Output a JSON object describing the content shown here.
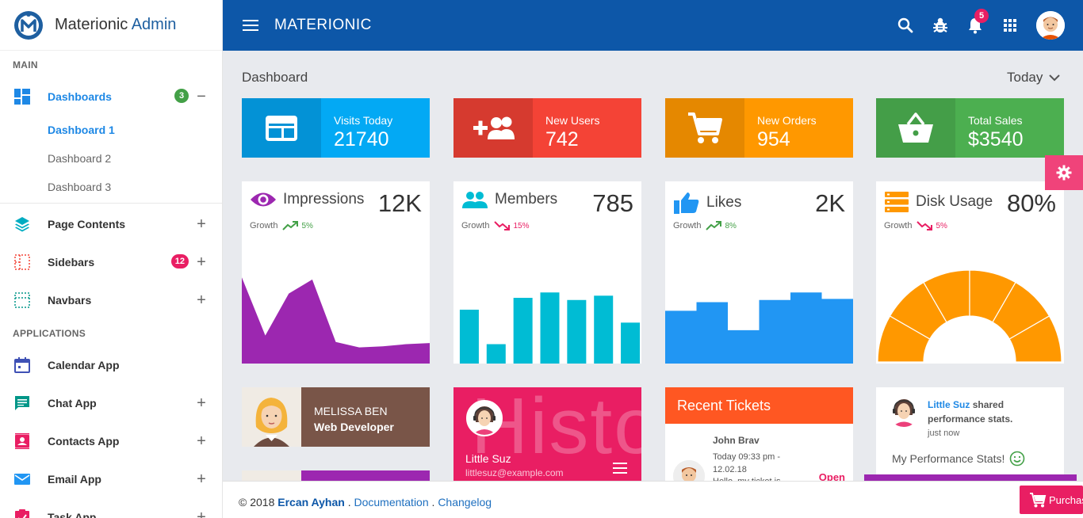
{
  "brand": {
    "name_part1": "Materionic",
    "name_part2": "Admin"
  },
  "sidebar": {
    "section_main": "MAIN",
    "section_apps": "APPLICATIONS",
    "dashboards": {
      "label": "Dashboards",
      "badge": "3",
      "toggle": "−",
      "icon": "dashboard-icon"
    },
    "sub_items": [
      "Dashboard 1",
      "Dashboard 2",
      "Dashboard 3"
    ],
    "page_contents": {
      "label": "Page Contents",
      "toggle": "+",
      "icon": "layers-icon"
    },
    "sidebars": {
      "label": "Sidebars",
      "badge": "12",
      "toggle": "+",
      "icon": "sidebar-grid-icon"
    },
    "navbars": {
      "label": "Navbars",
      "toggle": "+",
      "icon": "navbar-grid-icon"
    },
    "calendar": {
      "label": "Calendar App",
      "icon": "calendar-icon"
    },
    "chat": {
      "label": "Chat App",
      "toggle": "+",
      "icon": "chat-icon"
    },
    "contacts": {
      "label": "Contacts App",
      "toggle": "+",
      "icon": "contacts-icon"
    },
    "email": {
      "label": "Email App",
      "toggle": "+",
      "icon": "email-icon"
    },
    "task": {
      "label": "Task App",
      "toggle": "+",
      "icon": "task-icon"
    }
  },
  "topbar": {
    "title": "MATERIONIC",
    "notifications": "5"
  },
  "content": {
    "title": "Dashboard",
    "period": "Today"
  },
  "stats": [
    {
      "label": "Visits Today",
      "value": "21740",
      "color": "#03a9f4",
      "icon": "visits-icon"
    },
    {
      "label": "New Users",
      "value": "742",
      "color": "#f44336",
      "icon": "add-users-icon"
    },
    {
      "label": "New Orders",
      "value": "954",
      "color": "#ff9800",
      "icon": "cart-icon"
    },
    {
      "label": "Total Sales",
      "value": "$3540",
      "color": "#4caf50",
      "icon": "basket-icon"
    }
  ],
  "cards": {
    "impressions": {
      "title": "Impressions",
      "value": "12K",
      "growth_label": "Growth",
      "growth": "5%",
      "trend": "up",
      "icon": "eye-icon"
    },
    "members": {
      "title": "Members",
      "value": "785",
      "growth_label": "Growth",
      "growth": "15%",
      "trend": "down",
      "icon": "people-icon"
    },
    "likes": {
      "title": "Likes",
      "value": "2K",
      "growth_label": "Growth",
      "growth": "8%",
      "trend": "up",
      "icon": "thumbs-up-icon"
    },
    "disk": {
      "title": "Disk Usage",
      "value": "80%",
      "growth_label": "Growth",
      "growth": "5%",
      "trend": "down",
      "icon": "storage-icon"
    }
  },
  "chart_data": [
    {
      "type": "area",
      "title": "Impressions",
      "values": [
        80,
        26,
        65,
        78,
        20,
        15,
        16,
        18,
        19
      ],
      "color": "#9c27b0",
      "ylim": [
        0,
        100
      ]
    },
    {
      "type": "bar",
      "title": "Members",
      "values": [
        50,
        18,
        61,
        66,
        59,
        63,
        38
      ],
      "color": "#00bcd4",
      "ylim": [
        0,
        100
      ]
    },
    {
      "type": "area",
      "title": "Likes",
      "values": [
        49,
        57,
        31,
        59,
        66,
        60
      ],
      "color": "#2196f3",
      "ylim": [
        0,
        100
      ]
    },
    {
      "type": "pie",
      "title": "Disk Usage",
      "values": [
        80,
        20
      ],
      "color": "#ff9800"
    }
  ],
  "profile": {
    "name": "MELISSA BEN",
    "role": "Web Developer"
  },
  "history": {
    "bg_text": "Histo",
    "name": "Little Suz",
    "email": "littlesuz@example.com"
  },
  "tickets": {
    "title": "Recent Tickets",
    "name": "John Brav",
    "date_line": "Today 09:33 pm - 12.02.18",
    "more": "Hello, my ticket is",
    "status": "Open"
  },
  "activity": {
    "user": "Little Suz",
    "action": "shared performance stats.",
    "time": "just now",
    "message": "My Performance Stats!"
  },
  "footer": {
    "copyright": "© 2018",
    "author": "Ercan Ayhan",
    "sep1": ".",
    "docs": "Documentation",
    "sep2": ".",
    "changelog": "Changelog"
  },
  "purchase": {
    "label": "Purchase"
  }
}
